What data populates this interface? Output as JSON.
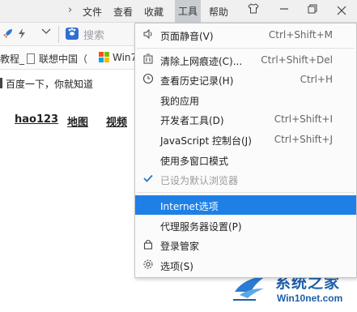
{
  "menubar": {
    "chevron": "›",
    "file": "文件",
    "view": "查看",
    "favorites": "收藏",
    "tools": "工具",
    "help": "帮助"
  },
  "window_controls": {
    "skin_icon": "shirt-icon",
    "minimize_icon": "minimize-icon",
    "maximize_icon": "restore-icon",
    "close_icon": "close-icon"
  },
  "toolbar": {
    "search_placeholder": "搜索",
    "icons": [
      "rocket-icon",
      "lightning-icon",
      "chevron-down-icon",
      "baidu-paw-icon"
    ]
  },
  "bookmarks": [
    {
      "label": "教程_",
      "icon": "none"
    },
    {
      "label": "联想中国（",
      "icon": "document-icon"
    },
    {
      "label": "Win7",
      "icon": "windows-logo-icon"
    }
  ],
  "page": {
    "address_text": "百度一下，你就知道",
    "nav_links": [
      "hao123",
      "地图",
      "视频"
    ]
  },
  "tools_menu": {
    "items": [
      {
        "label": "页面静音(V)",
        "shortcut": "Ctrl+Shift+M",
        "icon": "speaker-icon",
        "disabled": false,
        "highlighted": false
      },
      {
        "label": "清除上网痕迹(C)...",
        "shortcut": "Ctrl+Shift+Del",
        "icon": "broom-icon",
        "disabled": false,
        "highlighted": false
      },
      {
        "label": "查看历史记录(H)",
        "shortcut": "Ctrl+H",
        "icon": "clock-icon",
        "disabled": false,
        "highlighted": false
      },
      {
        "label": "我的应用",
        "shortcut": "",
        "icon": "none",
        "disabled": false,
        "highlighted": false
      },
      {
        "label": "开发者工具(D)",
        "shortcut": "Ctrl+Shift+I",
        "icon": "none",
        "disabled": false,
        "highlighted": false
      },
      {
        "label": "JavaScript 控制台(J)",
        "shortcut": "Ctrl+Shift+J",
        "icon": "none",
        "disabled": false,
        "highlighted": false
      },
      {
        "label": "使用多窗口模式",
        "shortcut": "",
        "icon": "none",
        "disabled": false,
        "highlighted": false
      },
      {
        "label": "已设为默认浏览器",
        "shortcut": "",
        "icon": "checkmark-icon",
        "disabled": true,
        "highlighted": false
      },
      {
        "label": "Internet选项",
        "shortcut": "",
        "icon": "none",
        "disabled": false,
        "highlighted": true
      },
      {
        "label": "代理服务器设置(P)",
        "shortcut": "",
        "icon": "none",
        "disabled": false,
        "highlighted": false
      },
      {
        "label": "登录管家",
        "shortcut": "",
        "icon": "lock-icon",
        "disabled": false,
        "highlighted": false
      },
      {
        "label": "选项(S)",
        "shortcut": "",
        "icon": "gear-icon",
        "disabled": false,
        "highlighted": false
      }
    ],
    "highlight_color": "#1e80e6"
  },
  "watermark": {
    "brand": "系统之家",
    "url": "Win10net.com"
  },
  "colors": {
    "accent": "#1e80e6",
    "watermark": "#1d5fa8"
  }
}
